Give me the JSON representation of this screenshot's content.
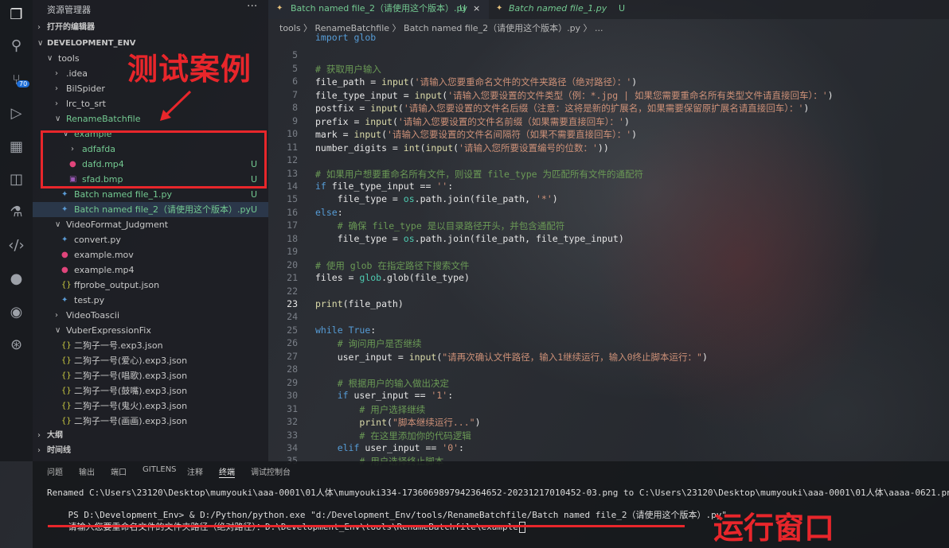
{
  "sidebar": {
    "title": "资源管理器",
    "more": "···",
    "open_editors": "打开的编辑器",
    "workspace": "DEVELOPMENT_ENV",
    "tree": [
      {
        "label": "tools",
        "chev": "∨",
        "indent": 1
      },
      {
        "label": ".idea",
        "chev": "›",
        "indent": 2
      },
      {
        "label": "BilSpider",
        "chev": "›",
        "indent": 2
      },
      {
        "label": "lrc_to_srt",
        "chev": "›",
        "indent": 2
      },
      {
        "label": "RenameBatchfile",
        "chev": "∨",
        "indent": 2,
        "color": "#73c991"
      },
      {
        "label": "example",
        "chev": "∨",
        "indent": 3,
        "color": "#73c991"
      },
      {
        "label": "adfafda",
        "chev": "›",
        "indent": 4,
        "color": "#73c991"
      },
      {
        "label": "dafd.mp4",
        "icon": "video",
        "indent": 4,
        "color": "#73c991",
        "status": "U"
      },
      {
        "label": "sfad.bmp",
        "icon": "image",
        "indent": 4,
        "color": "#73c991",
        "status": "U"
      },
      {
        "label": "Batch named file_1.py",
        "icon": "python",
        "indent": 3,
        "color": "#73c991",
        "status": "U"
      },
      {
        "label": "Batch named file_2（请使用这个版本）.py",
        "icon": "python",
        "indent": 3,
        "color": "#73c991",
        "status": "U"
      },
      {
        "label": "VideoFormat_Judgment",
        "chev": "∨",
        "indent": 2
      },
      {
        "label": "convert.py",
        "icon": "python",
        "indent": 3
      },
      {
        "label": "example.mov",
        "icon": "video",
        "indent": 3
      },
      {
        "label": "example.mp4",
        "icon": "video",
        "indent": 3
      },
      {
        "label": "ffprobe_output.json",
        "icon": "json",
        "indent": 3
      },
      {
        "label": "test.py",
        "icon": "python",
        "indent": 3
      },
      {
        "label": "VideoToascii",
        "chev": "›",
        "indent": 2
      },
      {
        "label": "VuberExpressionFix",
        "chev": "∨",
        "indent": 2
      },
      {
        "label": "二狗子一号.exp3.json",
        "icon": "json",
        "indent": 3
      },
      {
        "label": "二狗子一号(爱心).exp3.json",
        "icon": "json",
        "indent": 3
      },
      {
        "label": "二狗子一号(唱歌).exp3.json",
        "icon": "json",
        "indent": 3
      },
      {
        "label": "二狗子一号(鼓嘴).exp3.json",
        "icon": "json",
        "indent": 3
      },
      {
        "label": "二狗子一号(鬼火).exp3.json",
        "icon": "json",
        "indent": 3
      },
      {
        "label": "二狗子一号(画画).exp3.json",
        "icon": "json",
        "indent": 3
      }
    ],
    "outline": "大纲",
    "timeline": "时间线"
  },
  "tabs": [
    {
      "label": "Batch named file_2（请使用这个版本）.py",
      "status": "U",
      "close": "×"
    },
    {
      "label": "Batch named file_1.py",
      "status": "U"
    }
  ],
  "breadcrumbs": "tools 〉 RenameBatchfile 〉 Batch named file_2（请使用这个版本）.py 〉 ...",
  "code_lines": [
    {
      "n": "",
      "t": "import glob",
      "cls": "k"
    },
    {
      "n": "5",
      "t": ""
    },
    {
      "n": "5",
      "t": "# 获取用户输入",
      "cls": "c"
    },
    {
      "n": "6",
      "t": "file_path = input('请输入您要重命名文件的文件夹路径（绝对路径）：')"
    },
    {
      "n": "7",
      "t": "file_type_input = input('请输入您要设置的文件类型（例：*.jpg | 如果您需要重命名所有类型文件请直接回车）：')"
    },
    {
      "n": "8",
      "t": "postfix = input('请输入您要设置的文件名后缀（注意：这将是新的扩展名，如果需要保留原扩展名请直接回车）：')"
    },
    {
      "n": "9",
      "t": "prefix = input('请输入您要设置的文件名前缀（如果需要直接回车）：')"
    },
    {
      "n": "10",
      "t": "mark = input('请输入您要设置的文件名间隔符（如果不需要直接回车）：')"
    },
    {
      "n": "11",
      "t": "number_digits = int(input('请输入您所要设置编号的位数：'))"
    },
    {
      "n": "12",
      "t": ""
    },
    {
      "n": "13",
      "t": "# 如果用户想要重命名所有文件，则设置 file_type 为匹配所有文件的通配符",
      "cls": "c"
    },
    {
      "n": "14",
      "t": "if file_type_input == '':"
    },
    {
      "n": "15",
      "t": "    file_type = os.path.join(file_path, '*')"
    },
    {
      "n": "16",
      "t": "else:"
    },
    {
      "n": "17",
      "t": "    # 确保 file_type 是以目录路径开头，并包含通配符",
      "cls": "c"
    },
    {
      "n": "18",
      "t": "    file_type = os.path.join(file_path, file_type_input)"
    },
    {
      "n": "19",
      "t": ""
    },
    {
      "n": "20",
      "t": "# 使用 glob 在指定路径下搜索文件",
      "cls": "c"
    },
    {
      "n": "21",
      "t": "files = glob.glob(file_type)"
    },
    {
      "n": "22",
      "t": ""
    },
    {
      "n": "23",
      "t": "print(file_path)",
      "cur": true
    },
    {
      "n": "24",
      "t": ""
    },
    {
      "n": "25",
      "t": "while True:"
    },
    {
      "n": "26",
      "t": "    # 询问用户是否继续",
      "cls": "c"
    },
    {
      "n": "27",
      "t": "    user_input = input(\"请再次确认文件路径，输入1继续运行，输入0终止脚本运行：\")"
    },
    {
      "n": "28",
      "t": ""
    },
    {
      "n": "29",
      "t": "    # 根据用户的输入做出决定",
      "cls": "c"
    },
    {
      "n": "30",
      "t": "    if user_input == '1':"
    },
    {
      "n": "31",
      "t": "        # 用户选择继续",
      "cls": "c"
    },
    {
      "n": "32",
      "t": "        print(\"脚本继续运行...\")"
    },
    {
      "n": "33",
      "t": "        # 在这里添加你的代码逻辑",
      "cls": "c"
    },
    {
      "n": "34",
      "t": "    elif user_input == '0':"
    },
    {
      "n": "35",
      "t": "        # 用户选择终止脚本",
      "cls": "c"
    }
  ],
  "panel": {
    "tabs": [
      "问题",
      "输出",
      "端口",
      "GITLENS",
      "注释",
      "终端",
      "调试控制台"
    ],
    "active_tab": "终端",
    "terminal": [
      "Renamed C:\\Users\\23120\\Desktop\\mumyouki\\aaa-0001\\01人体\\mumyouki334-1736069897942364652-20231217010452-03.png to C:\\Users\\23120\\Desktop\\mumyouki\\aaa-0001\\01人体\\aaaa-0621.png",
      "PS D:\\Development_Env> & D:/Python/python.exe \"d:/Development_Env/tools/RenameBatchfile/Batch named file_2（请使用这个版本）.py\"",
      "请输入您要重命名文件的文件夹路径（绝对路径）：D:\\Development_Env\\tools\\RenameBatchfile\\example"
    ]
  },
  "annotations": {
    "test_cases": "测试案例",
    "run_window": "运行窗口",
    "color": "#e8262b"
  },
  "activity_icons": [
    "files-icon",
    "search-icon",
    "source-control-icon",
    "run-debug-icon",
    "extensions-icon",
    "remote-icon",
    "testing-icon",
    "code-icon",
    "github-icon",
    "gitlens-icon",
    "git-graph-icon"
  ]
}
